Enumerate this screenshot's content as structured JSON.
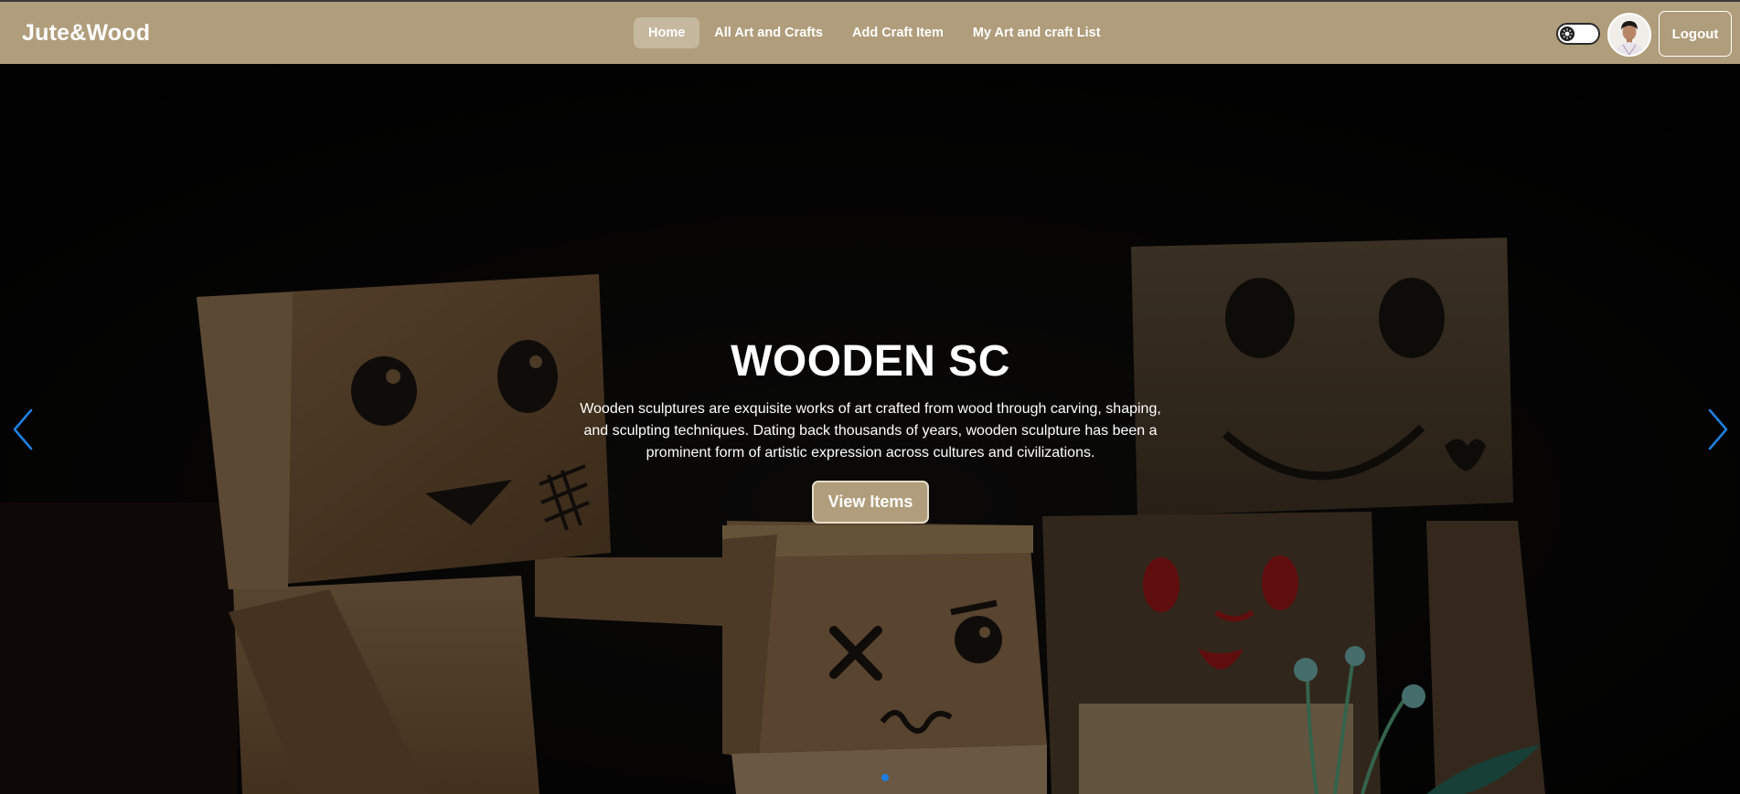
{
  "brand": {
    "name": "Jute&Wood"
  },
  "nav": {
    "links": [
      {
        "label": "Home",
        "active": true
      },
      {
        "label": "All Art and Crafts",
        "active": false
      },
      {
        "label": "Add Craft Item",
        "active": false
      },
      {
        "label": "My Art and craft List",
        "active": false
      }
    ]
  },
  "header": {
    "theme_toggle": {
      "icon": "sun-icon",
      "state": "light"
    },
    "avatar": {
      "icon": "user-avatar"
    },
    "logout_label": "Logout"
  },
  "hero": {
    "title": "WOODEN SC",
    "description": "Wooden sculptures are exquisite works of art crafted from wood through carving, shaping, and sculpting techniques. Dating back thousands of years, wooden sculpture has been a prominent form of artistic expression across cultures and civilizations.",
    "button_label": "View Items",
    "prev_icon": "chevron-left-icon",
    "next_icon": "chevron-right-icon"
  },
  "carousel": {
    "current_slide": 1
  },
  "colors": {
    "navbar": "#b09d7b",
    "accent_button": "#b09d7b",
    "arrow": "#1e7fe0",
    "text": "#ffffff"
  }
}
